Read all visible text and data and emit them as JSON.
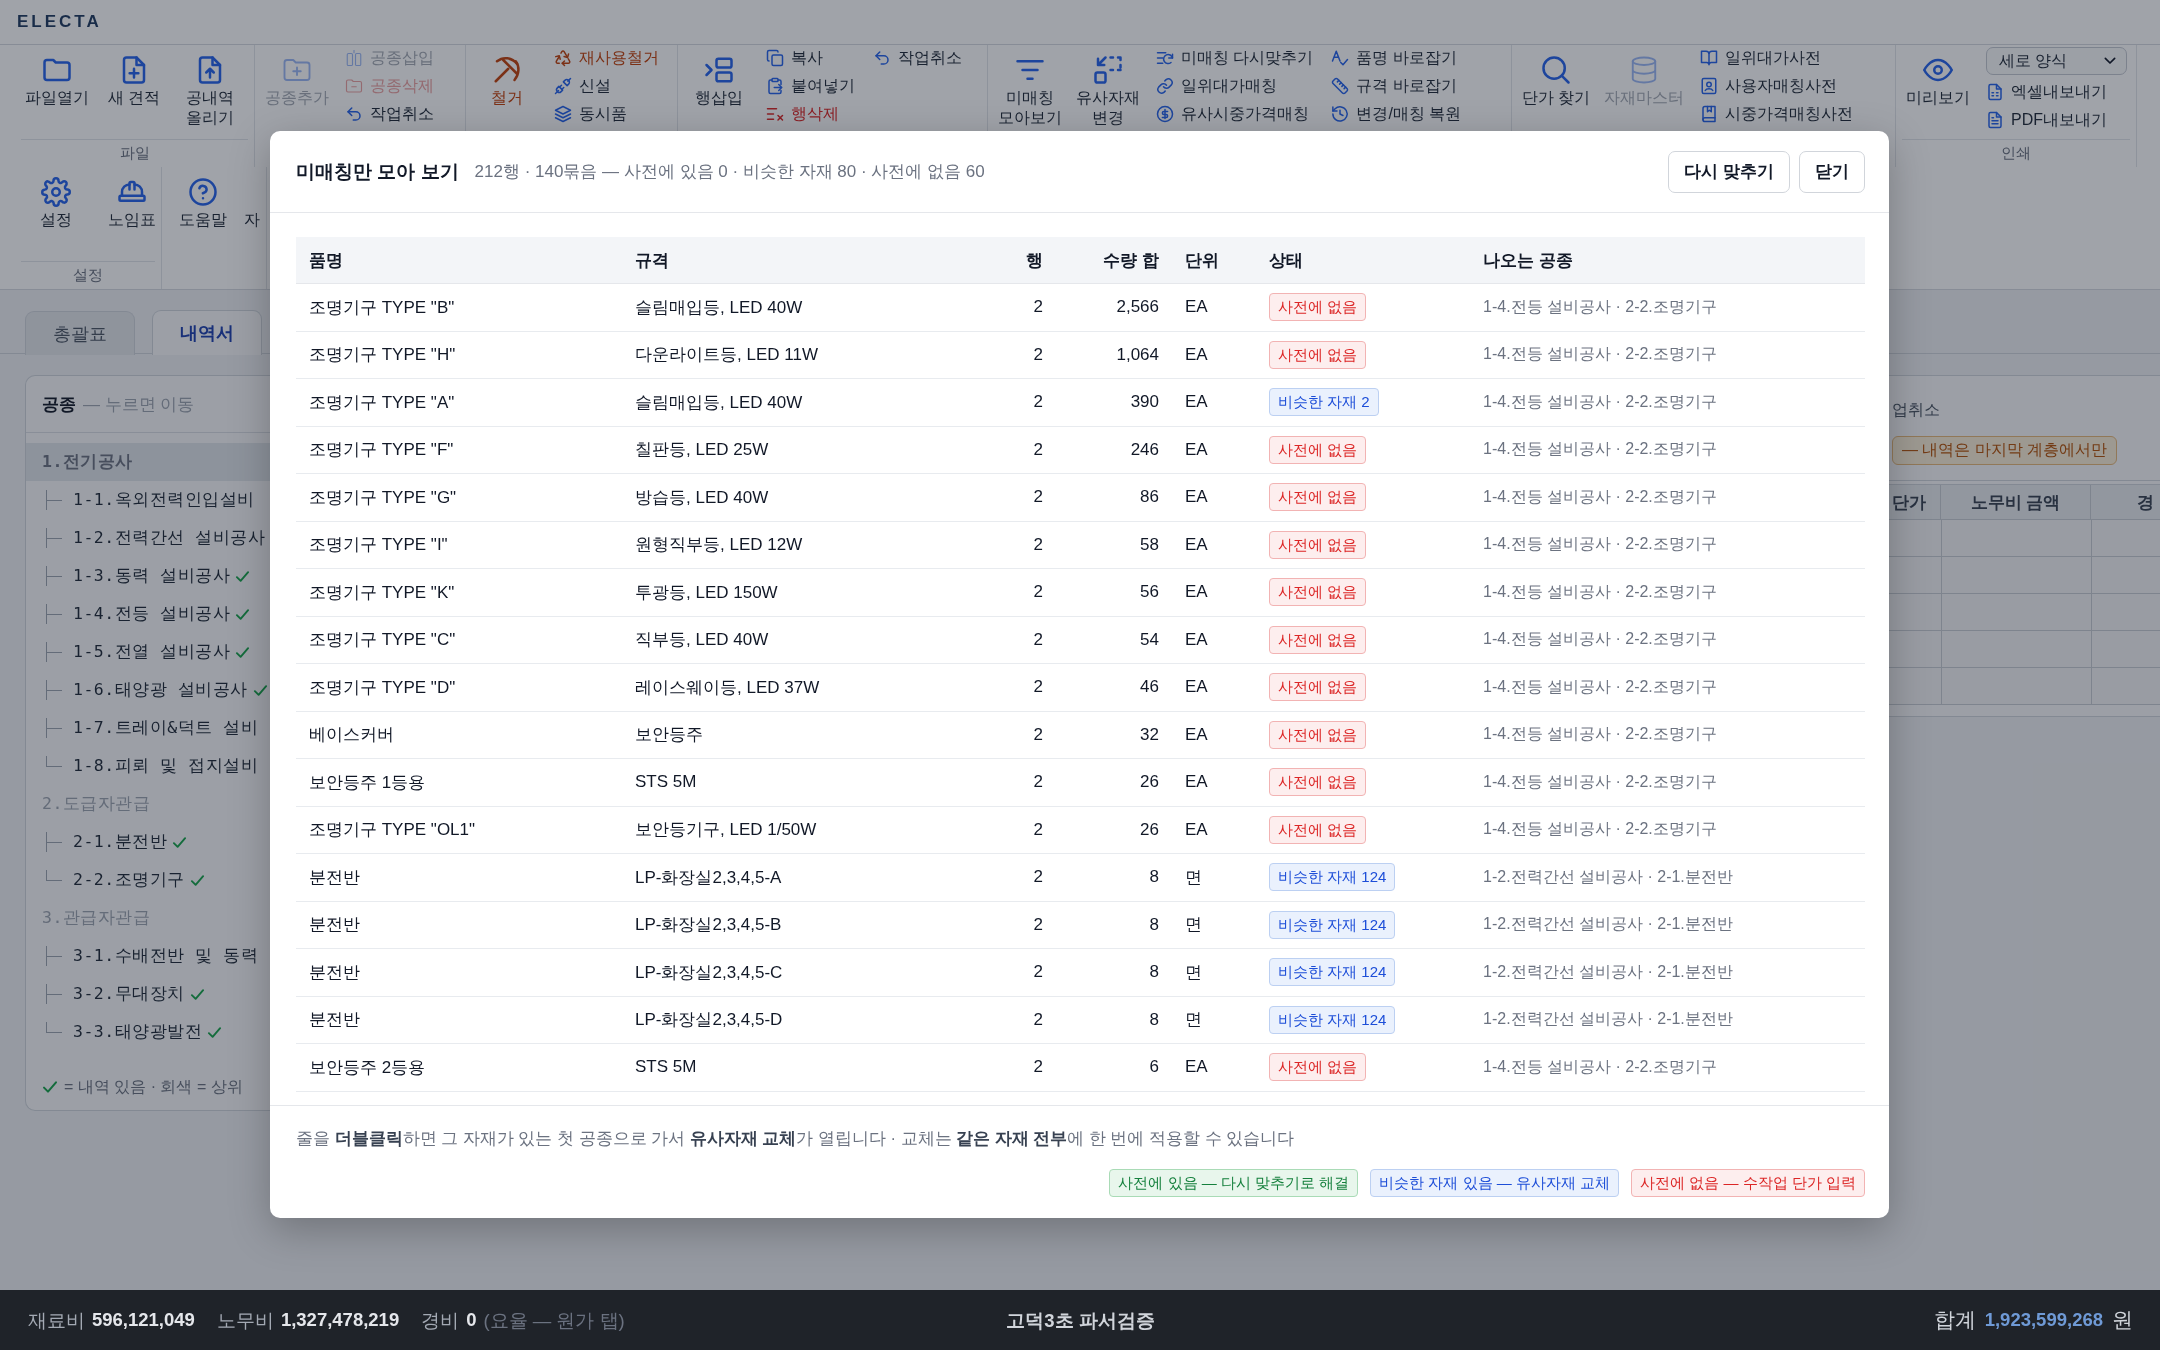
{
  "app": {
    "logo": "ELECTA"
  },
  "ribbon": {
    "groups": [
      {
        "label": "파일",
        "items": [
          {
            "kind": "large",
            "label": "파일열기",
            "disabled": false
          },
          {
            "kind": "large",
            "label": "새 견적",
            "disabled": false
          },
          {
            "kind": "large",
            "label": "공내역\n올리기",
            "disabled": false
          }
        ]
      },
      {
        "items": [
          {
            "kind": "large",
            "label": "공종추가",
            "disabled": true
          },
          {
            "kind": "small",
            "label": "공종삽입",
            "disabled": true
          },
          {
            "kind": "small",
            "label": "공종삭제",
            "disabled": true,
            "color": "#946a70"
          },
          {
            "kind": "small",
            "label": "작업취소",
            "disabled": false
          }
        ]
      },
      {
        "items": [
          {
            "kind": "large",
            "label": "철거",
            "disabled": false,
            "color": "#7b3117"
          },
          {
            "kind": "small",
            "label": "재사용철거",
            "disabled": false,
            "color": "#7b3117"
          },
          {
            "kind": "small",
            "label": "신설",
            "disabled": false
          },
          {
            "kind": "small",
            "label": "동시품",
            "disabled": false
          }
        ]
      },
      {
        "items": [
          {
            "kind": "large",
            "label": "행삽입",
            "disabled": false
          },
          {
            "kind": "small",
            "label": "복사",
            "disabled": false
          },
          {
            "kind": "small",
            "label": "붙여넣기",
            "disabled": false
          },
          {
            "kind": "small",
            "label": "행삭제",
            "disabled": false,
            "color": "#8b2026"
          },
          {
            "kind": "small",
            "label": "작업취소",
            "disabled": false
          }
        ]
      },
      {
        "items": [
          {
            "kind": "large",
            "label": "미매칭\n모아보기",
            "disabled": false
          },
          {
            "kind": "large",
            "label": "유사자재\n변경",
            "disabled": false
          },
          {
            "kind": "small",
            "label": "미매칭 다시맞추기",
            "disabled": false
          },
          {
            "kind": "small",
            "label": "일위대가매칭",
            "disabled": false
          },
          {
            "kind": "small",
            "label": "유사시중가격매칭",
            "disabled": false
          },
          {
            "kind": "small",
            "label": "품명 바로잡기",
            "disabled": false
          },
          {
            "kind": "small",
            "label": "규격 바로잡기",
            "disabled": false
          },
          {
            "kind": "small",
            "label": "변경/매칭 복원",
            "disabled": false
          }
        ]
      },
      {
        "items": [
          {
            "kind": "large",
            "label": "단가 찾기",
            "disabled": false
          },
          {
            "kind": "large",
            "label": "자재마스터",
            "disabled": true
          },
          {
            "kind": "small",
            "label": "일위대가사전",
            "disabled": false
          },
          {
            "kind": "small",
            "label": "사용자매칭사전",
            "disabled": false
          },
          {
            "kind": "small",
            "label": "시중가격매칭사전",
            "disabled": false
          }
        ]
      },
      {
        "label": "인쇄",
        "items": [
          {
            "kind": "large",
            "label": "미리보기",
            "disabled": false
          },
          {
            "kind": "select",
            "value": "세로 양식",
            "disabled": false
          },
          {
            "kind": "small",
            "label": "엑셀내보내기",
            "disabled": false
          },
          {
            "kind": "small",
            "label": "PDF내보내기",
            "disabled": false
          }
        ]
      },
      {
        "label": "설정",
        "items": [
          {
            "kind": "large",
            "label": "설정",
            "disabled": false
          },
          {
            "kind": "large",
            "label": "노임표",
            "disabled": false
          }
        ]
      },
      {
        "items": [
          {
            "kind": "large",
            "label": "도움말",
            "disabled": false
          },
          {
            "kind": "large",
            "label": "자",
            "disabled": false
          }
        ]
      }
    ]
  },
  "tabs": [
    {
      "label": "총괄표",
      "selected": false
    },
    {
      "label": "내역서",
      "selected": true
    }
  ],
  "sidebar": {
    "title": "공종",
    "hint": "— 누르면 이동",
    "tree": [
      {
        "label": "1.전기공사",
        "selected": true,
        "checked": false,
        "children": [
          {
            "label": "1-1.옥외전력인입설비",
            "selected": false
          },
          {
            "label": "1-2.전력간선 설비공사",
            "selected": false
          },
          {
            "label": "1-3.동력 설비공사",
            "selected": false,
            "checked": true
          },
          {
            "label": "1-4.전등 설비공사",
            "selected": false,
            "checked": true
          },
          {
            "label": "1-5.전열 설비공사",
            "selected": false,
            "checked": true
          },
          {
            "label": "1-6.태양광 설비공사",
            "selected": false,
            "checked": true
          },
          {
            "label": "1-7.트레이&덕트 설비",
            "selected": false
          },
          {
            "label": "1-8.피뢰 및 접지설비",
            "selected": false
          }
        ]
      },
      {
        "label": "2.도급자관급",
        "selected": false,
        "checked": false,
        "children": [
          {
            "label": "2-1.분전반",
            "selected": false,
            "checked": true
          },
          {
            "label": "2-2.조명기구",
            "selected": false,
            "checked": true
          }
        ]
      },
      {
        "label": "3.관급자관급",
        "selected": false,
        "checked": false,
        "children": [
          {
            "label": "3-1.수배전반 및 동력",
            "selected": false
          },
          {
            "label": "3-2.무대장치",
            "selected": false,
            "checked": true
          },
          {
            "label": "3-3.태양광발전",
            "selected": false,
            "checked": true
          }
        ]
      }
    ],
    "legend": "= 내역 있음 · 회색 = 상위"
  },
  "detail_panel": {
    "toolbar_button": "업취소",
    "notice": "— 내역은 마지막 계층에서만",
    "columns": [
      "단가",
      "노무비 금액",
      "경"
    ]
  },
  "dialog": {
    "title": "미매칭만 모아 보기",
    "summary": "212행 · 140묶음 — 사전에 있음 0 · 비슷한 자재 80 · 사전에 없음 60",
    "buttons": [
      "다시 맞추기",
      "닫기"
    ],
    "columns": [
      "품명",
      "규격",
      "행",
      "수량 합",
      "단위",
      "상태",
      "나오는 공종"
    ],
    "rows": [
      {
        "item": "조명기구 TYPE \"B\"",
        "spec": "슬림매입등, LED 40W",
        "lines": "2",
        "quantity": "2,566",
        "unit": "EA",
        "status": {
          "kind": "missing",
          "label": "사전에 없음"
        },
        "sources": "1-4.전등 설비공사 · 2-2.조명기구"
      },
      {
        "item": "조명기구 TYPE \"H\"",
        "spec": "다운라이트등, LED 11W",
        "lines": "2",
        "quantity": "1,064",
        "unit": "EA",
        "status": {
          "kind": "missing",
          "label": "사전에 없음"
        },
        "sources": "1-4.전등 설비공사 · 2-2.조명기구"
      },
      {
        "item": "조명기구 TYPE \"A\"",
        "spec": "슬림매입등, LED 40W",
        "lines": "2",
        "quantity": "390",
        "unit": "EA",
        "status": {
          "kind": "similar",
          "label": "비슷한 자재 2"
        },
        "sources": "1-4.전등 설비공사 · 2-2.조명기구"
      },
      {
        "item": "조명기구 TYPE \"F\"",
        "spec": "칠판등, LED 25W",
        "lines": "2",
        "quantity": "246",
        "unit": "EA",
        "status": {
          "kind": "missing",
          "label": "사전에 없음"
        },
        "sources": "1-4.전등 설비공사 · 2-2.조명기구"
      },
      {
        "item": "조명기구 TYPE \"G\"",
        "spec": "방습등, LED 40W",
        "lines": "2",
        "quantity": "86",
        "unit": "EA",
        "status": {
          "kind": "missing",
          "label": "사전에 없음"
        },
        "sources": "1-4.전등 설비공사 · 2-2.조명기구"
      },
      {
        "item": "조명기구 TYPE \"I\"",
        "spec": "원형직부등, LED 12W",
        "lines": "2",
        "quantity": "58",
        "unit": "EA",
        "status": {
          "kind": "missing",
          "label": "사전에 없음"
        },
        "sources": "1-4.전등 설비공사 · 2-2.조명기구"
      },
      {
        "item": "조명기구 TYPE \"K\"",
        "spec": "투광등, LED 150W",
        "lines": "2",
        "quantity": "56",
        "unit": "EA",
        "status": {
          "kind": "missing",
          "label": "사전에 없음"
        },
        "sources": "1-4.전등 설비공사 · 2-2.조명기구"
      },
      {
        "item": "조명기구 TYPE \"C\"",
        "spec": "직부등, LED 40W",
        "lines": "2",
        "quantity": "54",
        "unit": "EA",
        "status": {
          "kind": "missing",
          "label": "사전에 없음"
        },
        "sources": "1-4.전등 설비공사 · 2-2.조명기구"
      },
      {
        "item": "조명기구 TYPE \"D\"",
        "spec": "레이스웨이등, LED 37W",
        "lines": "2",
        "quantity": "46",
        "unit": "EA",
        "status": {
          "kind": "missing",
          "label": "사전에 없음"
        },
        "sources": "1-4.전등 설비공사 · 2-2.조명기구"
      },
      {
        "item": "베이스커버",
        "spec": "보안등주",
        "lines": "2",
        "quantity": "32",
        "unit": "EA",
        "status": {
          "kind": "missing",
          "label": "사전에 없음"
        },
        "sources": "1-4.전등 설비공사 · 2-2.조명기구"
      },
      {
        "item": "보안등주 1등용",
        "spec": "STS 5M",
        "lines": "2",
        "quantity": "26",
        "unit": "EA",
        "status": {
          "kind": "missing",
          "label": "사전에 없음"
        },
        "sources": "1-4.전등 설비공사 · 2-2.조명기구"
      },
      {
        "item": "조명기구 TYPE \"OL1\"",
        "spec": "보안등기구, LED 1/50W",
        "lines": "2",
        "quantity": "26",
        "unit": "EA",
        "status": {
          "kind": "missing",
          "label": "사전에 없음"
        },
        "sources": "1-4.전등 설비공사 · 2-2.조명기구"
      },
      {
        "item": "분전반",
        "spec": "LP-화장실2,3,4,5-A",
        "lines": "2",
        "quantity": "8",
        "unit": "면",
        "status": {
          "kind": "similar",
          "label": "비슷한 자재 124"
        },
        "sources": "1-2.전력간선 설비공사 · 2-1.분전반"
      },
      {
        "item": "분전반",
        "spec": "LP-화장실2,3,4,5-B",
        "lines": "2",
        "quantity": "8",
        "unit": "면",
        "status": {
          "kind": "similar",
          "label": "비슷한 자재 124"
        },
        "sources": "1-2.전력간선 설비공사 · 2-1.분전반"
      },
      {
        "item": "분전반",
        "spec": "LP-화장실2,3,4,5-C",
        "lines": "2",
        "quantity": "8",
        "unit": "면",
        "status": {
          "kind": "similar",
          "label": "비슷한 자재 124"
        },
        "sources": "1-2.전력간선 설비공사 · 2-1.분전반"
      },
      {
        "item": "분전반",
        "spec": "LP-화장실2,3,4,5-D",
        "lines": "2",
        "quantity": "8",
        "unit": "면",
        "status": {
          "kind": "similar",
          "label": "비슷한 자재 124"
        },
        "sources": "1-2.전력간선 설비공사 · 2-1.분전반"
      },
      {
        "item": "보안등주 2등용",
        "spec": "STS 5M",
        "lines": "2",
        "quantity": "6",
        "unit": "EA",
        "status": {
          "kind": "missing",
          "label": "사전에 없음"
        },
        "sources": "1-4.전등 설비공사 · 2-2.조명기구"
      }
    ],
    "help": "줄을 **더블클릭**하면 그 자재가 있는 첫 공종으로 가서 **유사자재 교체**가 열립니다 · 교체는 **같은 자재 전부**에 한 번에 적용할 수 있습니다",
    "legend": [
      {
        "kind": "in_dictionary",
        "label": "사전에 있음 — 다시 맞추기로 해결"
      },
      {
        "kind": "similar",
        "label": "비슷한 자재 있음 — 유사자재 교체"
      },
      {
        "kind": "missing",
        "label": "사전에 없음 — 수작업 단가 입력"
      }
    ]
  },
  "status_bar": {
    "items": [
      {
        "label": "재료비",
        "value": "596,121,049"
      },
      {
        "label": "노무비",
        "value": "1,327,478,219"
      },
      {
        "label": "경비",
        "value": "0",
        "note": "(요율 — 원가 탭)"
      }
    ],
    "center": "고덕3초 파서검증",
    "total": {
      "label": "합계",
      "value": "1,923,599,268",
      "unit": "원"
    }
  }
}
